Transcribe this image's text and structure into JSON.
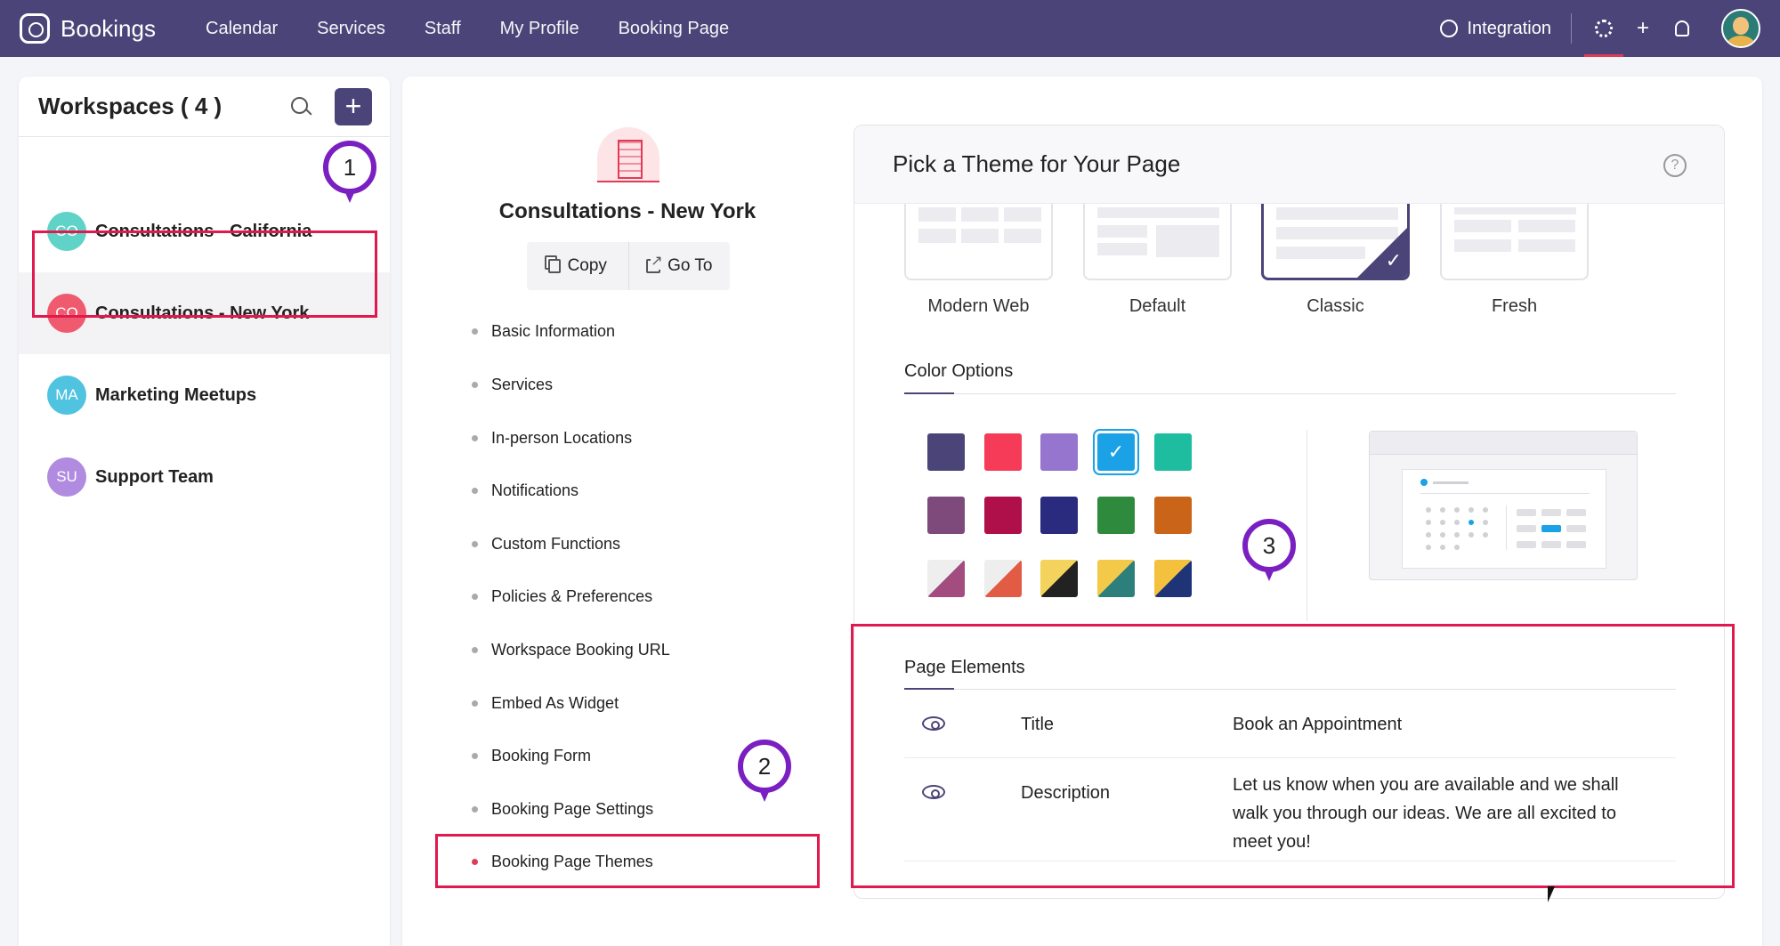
{
  "topbar": {
    "app_name": "Bookings",
    "nav": [
      "Calendar",
      "Services",
      "Staff",
      "My Profile",
      "Booking Page"
    ],
    "integration_label": "Integration",
    "icons": [
      "integration-icon",
      "gear-icon",
      "plus-icon",
      "bell-icon",
      "avatar"
    ]
  },
  "workspaces": {
    "title": "Workspaces ( 4 )",
    "items": [
      {
        "initials": "CO",
        "name": "Consultations - California",
        "color": "#5fd3c8"
      },
      {
        "initials": "CO",
        "name": "Consultations - New York",
        "color": "#f05a6e"
      },
      {
        "initials": "MA",
        "name": "Marketing Meetups",
        "color": "#4fc3e0"
      },
      {
        "initials": "SU",
        "name": "Support Team",
        "color": "#b08be0"
      }
    ]
  },
  "workspace": {
    "name": "Consultations - New York",
    "copy_label": "Copy",
    "goto_label": "Go To"
  },
  "menu": [
    "Basic Information",
    "Services",
    "In-person Locations",
    "Notifications",
    "Custom Functions",
    "Policies & Preferences",
    "Workspace Booking URL",
    "Embed As Widget",
    "Booking Form",
    "Booking Page Settings",
    "Booking Page Themes"
  ],
  "theme": {
    "heading": "Pick a Theme for Your Page",
    "help": "?",
    "themes": [
      "Modern Web",
      "Default",
      "Classic",
      "Fresh"
    ],
    "selected_theme": "Classic",
    "color_options_label": "Color Options",
    "colors": [
      "#4b4478",
      "#f53b57",
      "#9575cd",
      "#1ba1e6",
      "#1fbd9f",
      "#7e4a7c",
      "#b0104a",
      "#2a2a7e",
      "#2e8b3e",
      "#c96418"
    ],
    "selected_color": "#1ba1e6",
    "page_elements_label": "Page Elements",
    "elements": [
      {
        "name": "Title",
        "value": "Book an Appointment"
      },
      {
        "name": "Description",
        "value": "Let us know when you are available and we shall walk you through our ideas. We are all excited to meet you!"
      }
    ]
  },
  "callouts": [
    "1",
    "2",
    "3"
  ],
  "accent": "#e0194f"
}
